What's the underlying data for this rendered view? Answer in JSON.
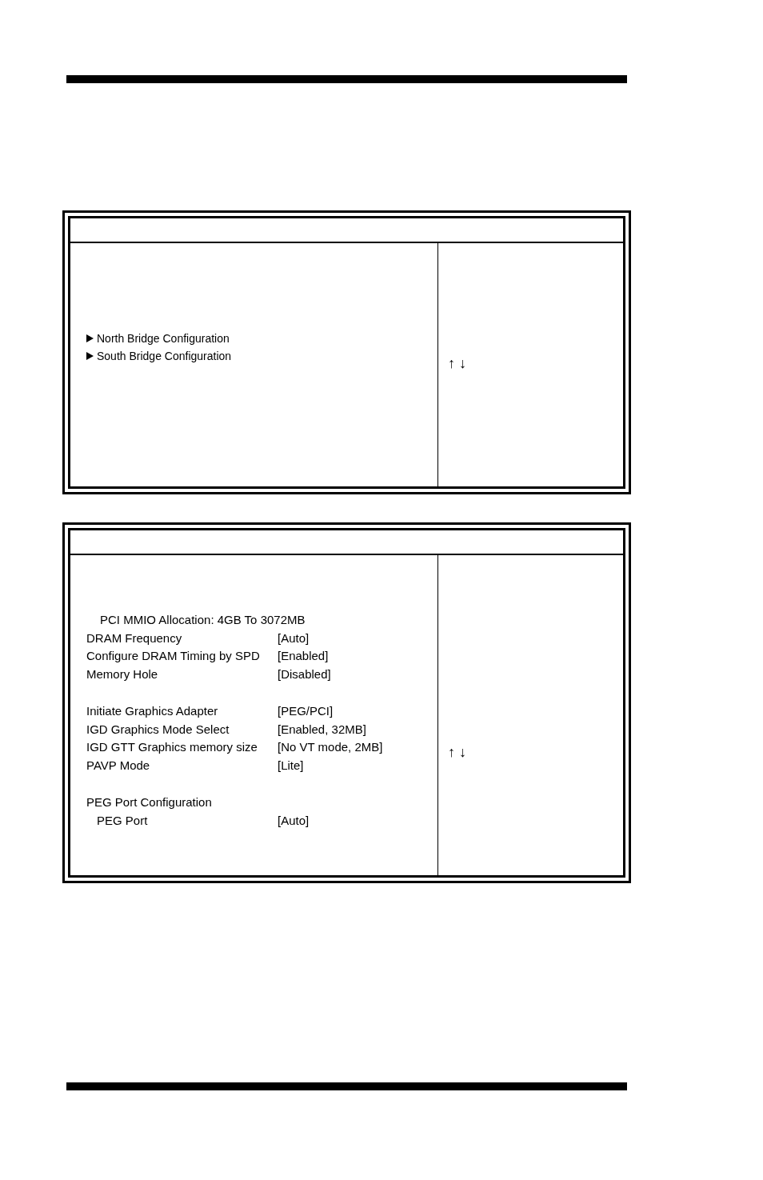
{
  "panels": [
    {
      "menu_items": [
        {
          "label": "North Bridge Configuration",
          "kind": "submenu"
        },
        {
          "label": "South Bridge Configuration",
          "kind": "submenu"
        }
      ],
      "help_keys": "↑ ↓"
    },
    {
      "groups": [
        [
          {
            "label": "PCI MMIO Allocation: 4GB To 3072MB",
            "kind": "info"
          },
          {
            "label": "DRAM Frequency",
            "value": "[Auto]",
            "kind": "setting"
          },
          {
            "label": "Configure DRAM Timing by SPD",
            "value": "[Enabled]",
            "kind": "setting"
          },
          {
            "label": "Memory Hole",
            "value": "[Disabled]",
            "kind": "setting"
          }
        ],
        [
          {
            "label": "Initiate Graphics Adapter",
            "value": "[PEG/PCI]",
            "kind": "setting"
          },
          {
            "label": "IGD Graphics Mode Select",
            "value": "[Enabled, 32MB]",
            "kind": "setting"
          },
          {
            "label": "IGD GTT Graphics memory size",
            "value": "[No VT mode, 2MB]",
            "kind": "setting"
          },
          {
            "label": "PAVP Mode",
            "value": "[Lite]",
            "kind": "setting"
          }
        ],
        [
          {
            "label": "PEG Port Configuration",
            "kind": "section",
            "children": [
              {
                "label": "PEG Port",
                "value": "[Auto]",
                "kind": "setting"
              }
            ]
          }
        ]
      ],
      "help_keys": "↑ ↓"
    }
  ]
}
